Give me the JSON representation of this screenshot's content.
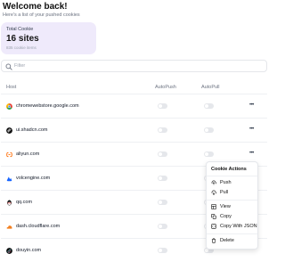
{
  "header": {
    "title": "Welcome back!",
    "subtitle": "Here's a list of your pushed cookies"
  },
  "stats": {
    "label": "Total Cookie",
    "value": "16 sites",
    "note": "835 cookie items"
  },
  "filter": {
    "placeholder": "Filter",
    "value": ""
  },
  "table": {
    "columns": [
      "Host",
      "AutoPush",
      "AutoPull"
    ],
    "rows": [
      {
        "host": "chromewebstore.google.com",
        "icon": "chrome-icon",
        "color": "#4285f4",
        "autopush": false,
        "autopull": false
      },
      {
        "host": "ui.shadcn.com",
        "icon": "shadcn-icon",
        "color": "#111111",
        "autopush": false,
        "autopull": false
      },
      {
        "host": "aliyun.com",
        "icon": "aliyun-icon",
        "color": "#ff6a00",
        "autopush": false,
        "autopull": false
      },
      {
        "host": "volcengine.com",
        "icon": "volcengine-icon",
        "color": "#1664ff",
        "autopush": false,
        "autopull": false
      },
      {
        "host": "qq.com",
        "icon": "qq-icon",
        "color": "#1296db",
        "autopush": false,
        "autopull": false
      },
      {
        "host": "dash.cloudflare.com",
        "icon": "cloudflare-icon",
        "color": "#f38020",
        "autopush": false,
        "autopull": false
      },
      {
        "host": "douyin.com",
        "icon": "douyin-icon",
        "color": "#111111",
        "autopush": false,
        "autopull": false
      }
    ]
  },
  "menu": {
    "title": "Cookie Actions",
    "items": [
      {
        "label": "Push",
        "icon": "upload-icon"
      },
      {
        "label": "Pull",
        "icon": "download-icon"
      },
      {
        "label": "View",
        "icon": "table-icon"
      },
      {
        "label": "Copy",
        "icon": "copy-icon"
      },
      {
        "label": "Copy With JSON",
        "icon": "json-icon"
      },
      {
        "label": "Delete",
        "icon": "trash-icon"
      }
    ]
  },
  "colors": {
    "card_bg": "#efeafb",
    "toggle_off": "#e5e7eb",
    "border": "#e5e7eb"
  }
}
